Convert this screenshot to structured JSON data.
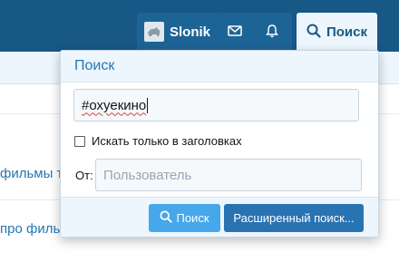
{
  "topbar": {
    "user_name": "Slonik",
    "search_label": "Поиск"
  },
  "background": {
    "row1_text": "фильмы тем",
    "row2_text": "про фильм"
  },
  "popup": {
    "title": "Поиск",
    "query_value": "#охуекино",
    "titles_only_label": "Искать только в заголовках",
    "titles_only_checked": false,
    "from_label": "От:",
    "user_placeholder": "Пользователь",
    "search_button_label": "Поиск",
    "advanced_button_label": "Расширенный поиск..."
  },
  "icons": {
    "user_avatar": "avatar-icon",
    "inbox": "envelope-icon",
    "alerts": "bell-icon",
    "search": "search-icon"
  },
  "colors": {
    "header_bg": "#185886",
    "accent": "#2577b1",
    "search_button": "#47a7eb",
    "advanced_button": "#2a73b3"
  }
}
